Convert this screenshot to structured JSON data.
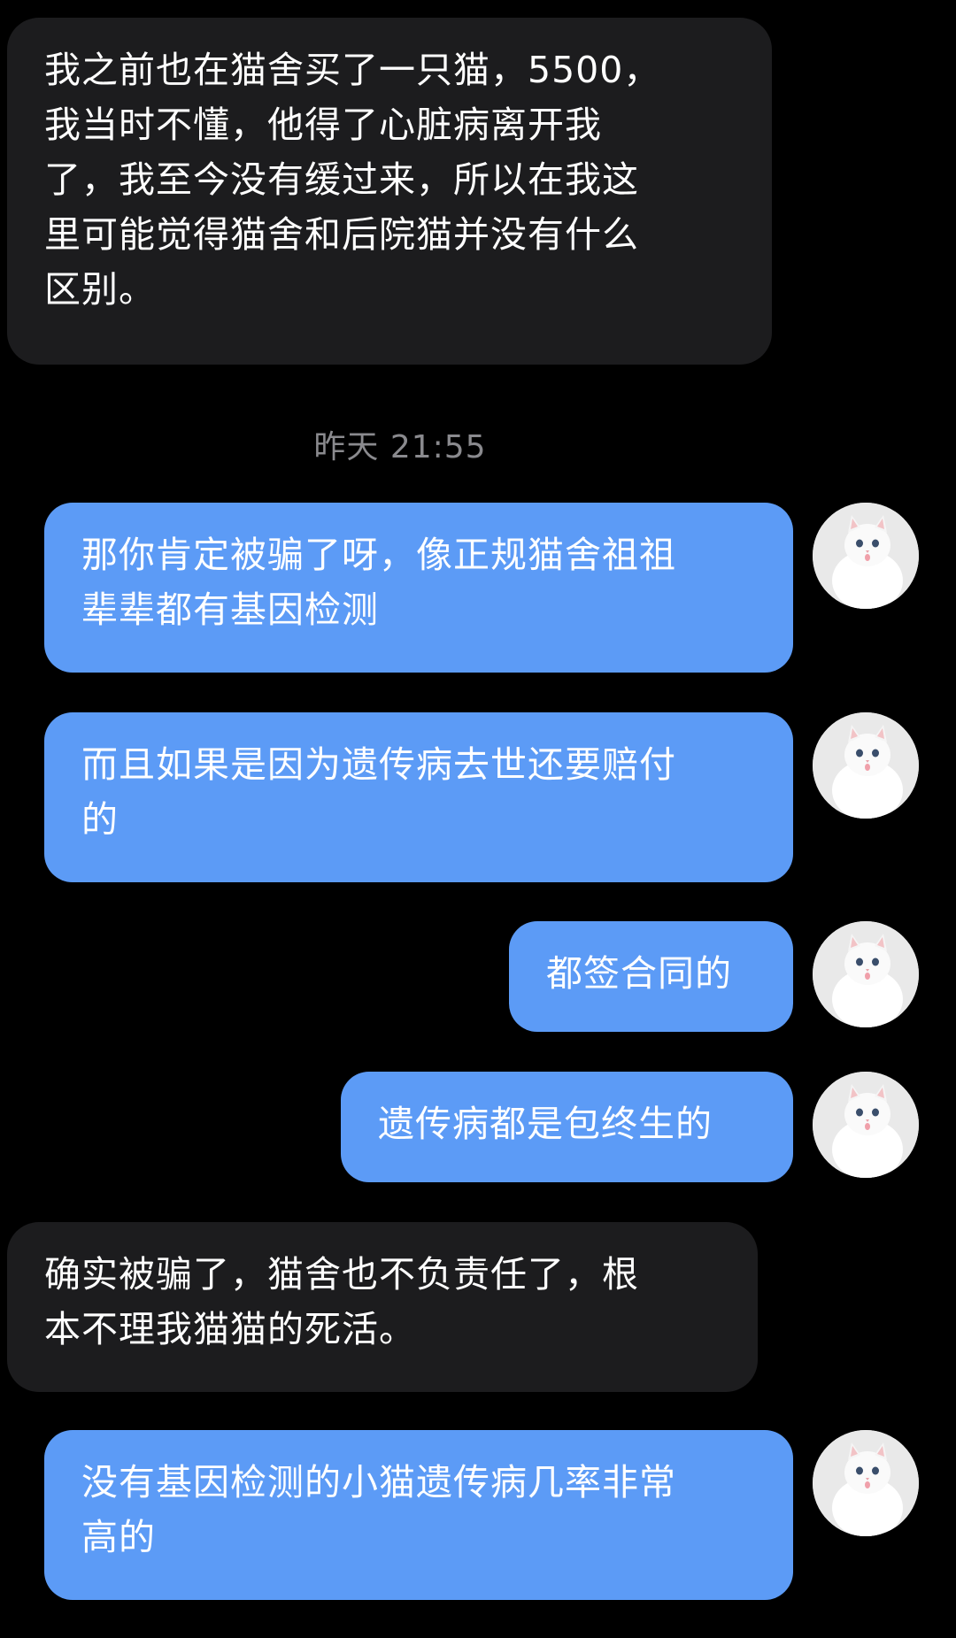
{
  "messages": [
    {
      "side": "left",
      "text": "我之前也在猫舍买了一只猫，5500，\n我当时不懂，他得了心脏病离开我\n了，我至今没有缓过来，所以在我这\n里可能觉得猫舍和后院猫并没有什么\n区别。"
    },
    {
      "side": "right",
      "text": "那你肯定被骗了呀，像正规猫舍祖祖\n辈辈都有基因检测"
    },
    {
      "side": "right",
      "text": "而且如果是因为遗传病去世还要赔付\n的"
    },
    {
      "side": "right",
      "text": "都签合同的"
    },
    {
      "side": "right",
      "text": "遗传病都是包终生的"
    },
    {
      "side": "left",
      "text": "确实被骗了，猫舍也不负责任了，根\n本不理我猫猫的死活。"
    },
    {
      "side": "right",
      "text": "没有基因检测的小猫遗传病几率非常\n高的"
    }
  ],
  "timestamp": "昨天 21:55",
  "avatar_icon": "white-cat-avatar",
  "colors": {
    "background": "#000000",
    "left_bubble": "#1c1c1e",
    "right_bubble": "#5c9bf6",
    "timestamp_text": "#8a8a8e"
  }
}
